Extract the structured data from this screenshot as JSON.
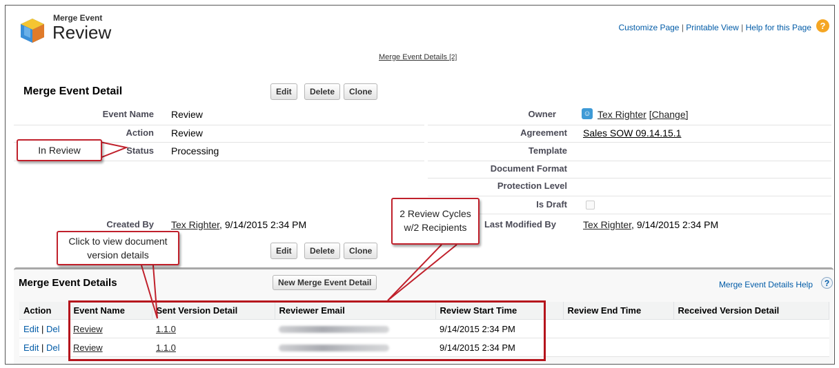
{
  "header": {
    "object_label": "Merge Event",
    "record_title": "Review",
    "customize": "Customize Page",
    "printable": "Printable View",
    "help": "Help for this Page",
    "sep": "|",
    "related_link": "Merge Event Details",
    "related_count": "[2]"
  },
  "detail": {
    "title": "Merge Event Detail",
    "buttons": {
      "edit": "Edit",
      "delete": "Delete",
      "clone": "Clone"
    },
    "fields": {
      "event_name": {
        "label": "Event Name",
        "value": "Review"
      },
      "action": {
        "label": "Action",
        "value": "Review"
      },
      "status": {
        "label": "Status",
        "value": "Processing"
      },
      "owner": {
        "label": "Owner",
        "value": "Tex Righter",
        "change": "[Change]"
      },
      "agreement": {
        "label": "Agreement",
        "value": "Sales SOW 09.14.15.1"
      },
      "template": {
        "label": "Template",
        "value": ""
      },
      "document_format": {
        "label": "Document Format",
        "value": ""
      },
      "protection_level": {
        "label": "Protection Level",
        "value": ""
      },
      "is_draft": {
        "label": "Is Draft",
        "checked": false
      },
      "created_by": {
        "label": "Created By",
        "user": "Tex Righter",
        "date": ", 9/14/2015 2:34 PM"
      },
      "last_modified_by": {
        "label": "Last Modified By",
        "user": "Tex Righter",
        "date": ", 9/14/2015 2:34 PM"
      }
    }
  },
  "related": {
    "title": "Merge Event Details",
    "new_button": "New Merge Event Detail",
    "help": "Merge Event Details Help",
    "columns": [
      "Action",
      "Event Name",
      "Sent Version Detail",
      "Reviewer Email",
      "Review Start Time",
      "Review End Time",
      "Received Version Detail"
    ],
    "rows": [
      {
        "edit": "Edit",
        "sep": "|",
        "del": "Del",
        "event_name": "Review",
        "sent_version": "1.1.0",
        "start": "9/14/2015 2:34 PM",
        "end": "",
        "received": ""
      },
      {
        "edit": "Edit",
        "sep": "|",
        "del": "Del",
        "event_name": "Review",
        "sent_version": "1.1.0",
        "start": "9/14/2015 2:34 PM",
        "end": "",
        "received": ""
      }
    ]
  },
  "annotations": {
    "in_review": "In Review",
    "cycles_line1": "2 Review Cycles",
    "cycles_line2": "w/2 Recipients",
    "click_line1": "Click to view document",
    "click_line2": "version details",
    "color": "#c0202b"
  }
}
